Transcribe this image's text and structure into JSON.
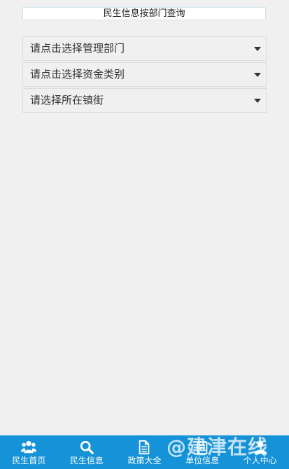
{
  "header": {
    "title": "民生信息按部门查询"
  },
  "filters": [
    {
      "label": "请点击选择管理部门"
    },
    {
      "label": "请点击选择资金类别"
    },
    {
      "label": "请选择所在镇街"
    }
  ],
  "tabbar": {
    "background": "#1592d8",
    "items": [
      {
        "label": "民生首页",
        "icon": "users-icon"
      },
      {
        "label": "民生信息",
        "icon": "search-icon"
      },
      {
        "label": "政策大全",
        "icon": "document-icon"
      },
      {
        "label": "单位信息",
        "icon": "building-icon"
      },
      {
        "label": "个人中心",
        "icon": "user-icon"
      }
    ]
  },
  "watermark": {
    "text": "@建津在线"
  }
}
